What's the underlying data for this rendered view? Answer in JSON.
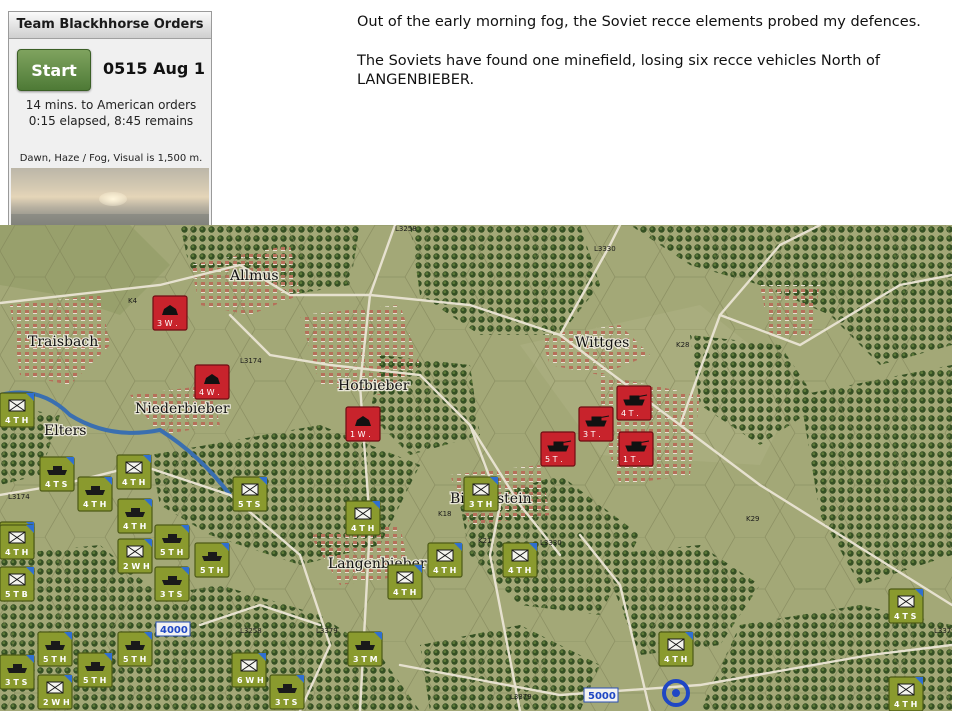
{
  "panel": {
    "title": "Team Blackhhorse Orders",
    "start_label": "Start",
    "datetime": "0515 Aug 1",
    "orders_line": "14 mins. to American orders",
    "elapsed_line": "0:15 elapsed, 8:45 remains",
    "weather": "Dawn, Haze / Fog, Visual is 1,500 m."
  },
  "report": {
    "paragraph1": "Out of the early morning fog, the Soviet recce elements probed my defences.",
    "paragraph2": "The Soviets have found one minefield, losing six recce vehicles North of LANGENBIEBER."
  },
  "map": {
    "towns": [
      "Allmus",
      "Traisbach",
      "Wittges",
      "Hofbieber",
      "Niederbieber",
      "Langenbieber",
      "Bieberstein",
      "Elters"
    ],
    "roads": [
      "L3258",
      "L3174",
      "K4",
      "L3174",
      "K28",
      "K18",
      "K21",
      "L3330",
      "K29",
      "L3258",
      "L3379",
      "L3379",
      "L3330",
      "L3379"
    ],
    "elevations": [
      "4000",
      "5000"
    ],
    "soviet_units": [
      {
        "id": "3W",
        "strength": "3",
        "grade": "W",
        "type": "recce-vehicle"
      },
      {
        "id": "4W",
        "strength": "4",
        "grade": "W",
        "type": "recce-vehicle"
      },
      {
        "id": "1W",
        "strength": "1",
        "grade": "W",
        "type": "recce-vehicle"
      },
      {
        "id": "4T",
        "strength": "4",
        "grade": "T",
        "type": "tank"
      },
      {
        "id": "3T",
        "strength": "3",
        "grade": "T",
        "type": "tank"
      },
      {
        "id": "5T",
        "strength": "5",
        "grade": "T",
        "type": "tank"
      },
      {
        "id": "1T",
        "strength": "1",
        "grade": "T",
        "type": "tank"
      }
    ],
    "nato_units": [
      {
        "label": "4 T",
        "grade": "H",
        "type": "infantry"
      },
      {
        "label": "4 T",
        "grade": "S",
        "type": "tank"
      },
      {
        "label": "4 T",
        "grade": "H",
        "type": "tank"
      },
      {
        "label": "4 T",
        "grade": "H",
        "type": "infantry"
      },
      {
        "label": "5 T",
        "grade": "S",
        "type": "infantry"
      },
      {
        "label": "6 W",
        "grade": "H",
        "type": "recon"
      },
      {
        "label": "2 W",
        "grade": "H",
        "type": "recon"
      },
      {
        "label": "5 T",
        "grade": "H",
        "type": "tank"
      },
      {
        "label": "5 T",
        "grade": "H",
        "type": "tank"
      },
      {
        "label": "5 T",
        "grade": "B",
        "type": "artillery"
      },
      {
        "label": "3 T",
        "grade": "S",
        "type": "tank"
      },
      {
        "label": "4 T",
        "grade": "H",
        "type": "tank"
      },
      {
        "label": "3 T",
        "grade": "H",
        "type": "infantry"
      },
      {
        "label": "4 T",
        "grade": "H",
        "type": "infantry"
      },
      {
        "label": "4 T",
        "grade": "H",
        "type": "infantry"
      },
      {
        "label": "4 T",
        "grade": "H",
        "type": "infantry"
      },
      {
        "label": "4 T",
        "grade": "H",
        "type": "infantry"
      },
      {
        "label": "5 T",
        "grade": "H",
        "type": "tank"
      },
      {
        "label": "5 T",
        "grade": "H",
        "type": "tank"
      },
      {
        "label": "3 T",
        "grade": "S",
        "type": "tank"
      },
      {
        "label": "5 T",
        "grade": "H",
        "type": "tank"
      },
      {
        "label": "3 T",
        "grade": "M",
        "type": "tank"
      },
      {
        "label": "4 T",
        "grade": "H",
        "type": "infantry"
      },
      {
        "label": "6 W",
        "grade": "H",
        "type": "infantry"
      },
      {
        "label": "2 W",
        "grade": "H",
        "type": "recon"
      },
      {
        "label": "4 T",
        "grade": "S",
        "type": "infantry"
      },
      {
        "label": "4 T",
        "grade": "H",
        "type": "infantry"
      },
      {
        "label": "3 T",
        "grade": "S",
        "type": "tank"
      },
      {
        "label": "4 T",
        "grade": "H",
        "type": "infantry"
      }
    ],
    "colors": {
      "soviet": "#c8232c",
      "nato": "#8a9a2e",
      "terrain": "#a3a877",
      "forest": "#3f5a2a",
      "river": "#3a6fb0",
      "town": "#b87a5e"
    }
  }
}
